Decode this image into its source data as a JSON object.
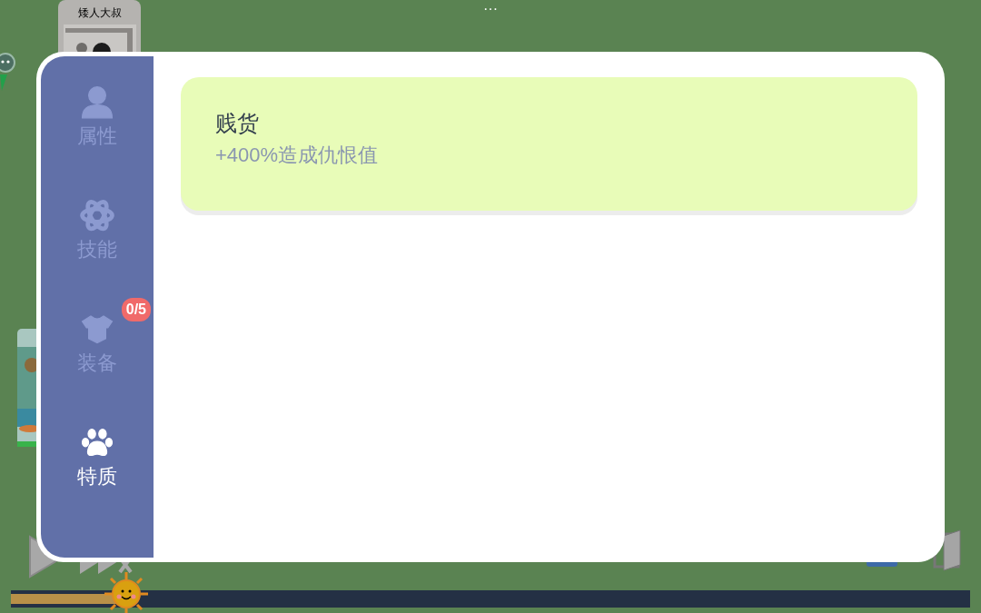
{
  "background": {
    "menu_dots": "···",
    "npc_card": {
      "name": "矮人大叔"
    },
    "day_progress": {
      "level": 0.12
    }
  },
  "dialog": {
    "tabs": [
      {
        "kind": "person",
        "label": "属性",
        "selected": false
      },
      {
        "kind": "atom",
        "label": "技能",
        "selected": false
      },
      {
        "kind": "armor",
        "label": "装备",
        "selected": false,
        "badge": "0/5"
      },
      {
        "kind": "paw",
        "label": "特质",
        "selected": true
      }
    ],
    "traits": [
      {
        "name": "贱货",
        "effect": "+400%造成仇恨值"
      }
    ]
  }
}
